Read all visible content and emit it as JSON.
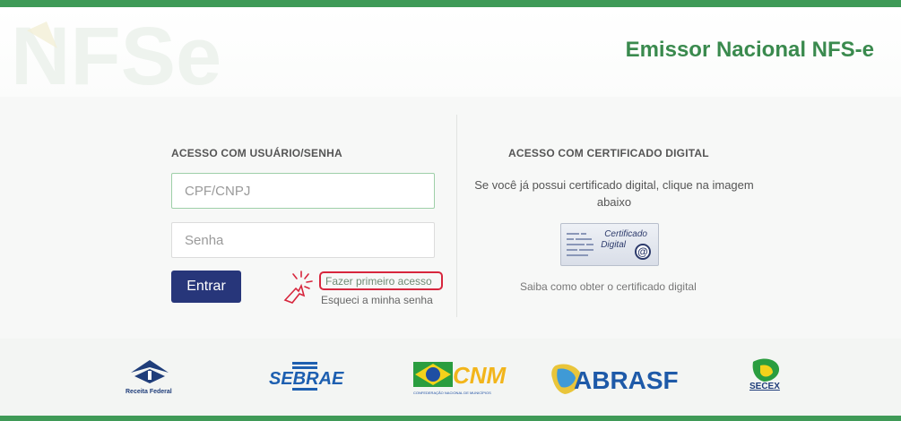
{
  "header": {
    "logo_text": "NFSe",
    "title": "Emissor Nacional NFS-e"
  },
  "login": {
    "section_title": "ACESSO COM USUÁRIO/SENHA",
    "cpf_placeholder": "CPF/CNPJ",
    "password_placeholder": "Senha",
    "enter_label": "Entrar",
    "first_access_label": "Fazer primeiro acesso",
    "forgot_label": "Esqueci a minha senha"
  },
  "certificate": {
    "section_title": "ACESSO COM CERTIFICADO DIGITAL",
    "instruction": "Se você já possui certificado digital, clique na imagem abaixo",
    "badge_line1": "Certificado",
    "badge_line2": "Digital",
    "how_to_link": "Saiba como obter o certificado digital"
  },
  "partners": {
    "receita": "Receita Federal",
    "sebrae": "SEBRAE",
    "cnm": "CNM",
    "cnm_sub": "CONFEDERAÇÃO NACIONAL DE MUNICÍPIOS",
    "abrasf": "ABRASF",
    "secex": "SECEX"
  },
  "colors": {
    "brand_green": "#3f9a57",
    "button_navy": "#27367a",
    "highlight_red": "#d7263d"
  }
}
